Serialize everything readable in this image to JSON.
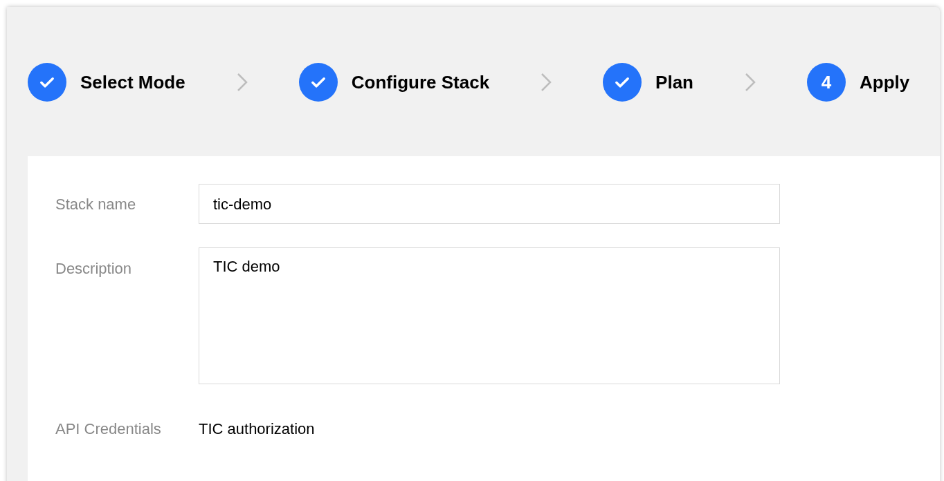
{
  "steps": [
    {
      "label": "Select Mode",
      "kind": "done"
    },
    {
      "label": "Configure Stack",
      "kind": "done"
    },
    {
      "label": "Plan",
      "kind": "done"
    },
    {
      "label": "Apply",
      "kind": "current",
      "number": "4"
    }
  ],
  "form": {
    "stack_name": {
      "label": "Stack name",
      "value": "tic-demo"
    },
    "description": {
      "label": "Description",
      "value": "TIC demo"
    },
    "api_credentials": {
      "label": "API Credentials",
      "value": "TIC authorization"
    }
  }
}
